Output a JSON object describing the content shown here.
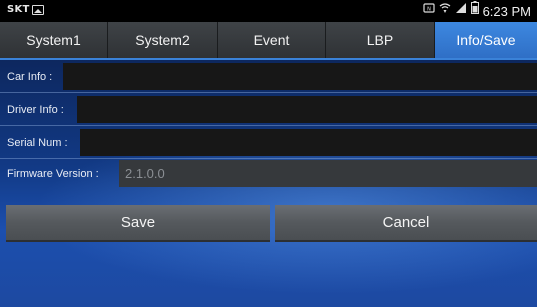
{
  "status_bar": {
    "carrier": "SKT",
    "time": "6:23 PM",
    "icons": [
      "image-icon",
      "nfc-icon",
      "wifi-icon",
      "signal-icon",
      "battery-icon"
    ]
  },
  "tabs": [
    {
      "label": "System1",
      "active": false
    },
    {
      "label": "System2",
      "active": false
    },
    {
      "label": "Event",
      "active": false
    },
    {
      "label": "LBP",
      "active": false
    },
    {
      "label": "Info/Save",
      "active": true
    }
  ],
  "form": {
    "car_info": {
      "label": "Car Info :",
      "value": ""
    },
    "driver_info": {
      "label": "Driver Info :",
      "value": ""
    },
    "serial_num": {
      "label": "Serial Num :",
      "value": ""
    },
    "firmware_version": {
      "label": "Firmware Version :",
      "value": "2.1.0.0"
    }
  },
  "buttons": {
    "save_label": "Save",
    "cancel_label": "Cancel"
  },
  "colors": {
    "active_tab": "#3d88e0",
    "tab": "#3f4347",
    "input_bg": "#171717",
    "background": "#123a86"
  }
}
